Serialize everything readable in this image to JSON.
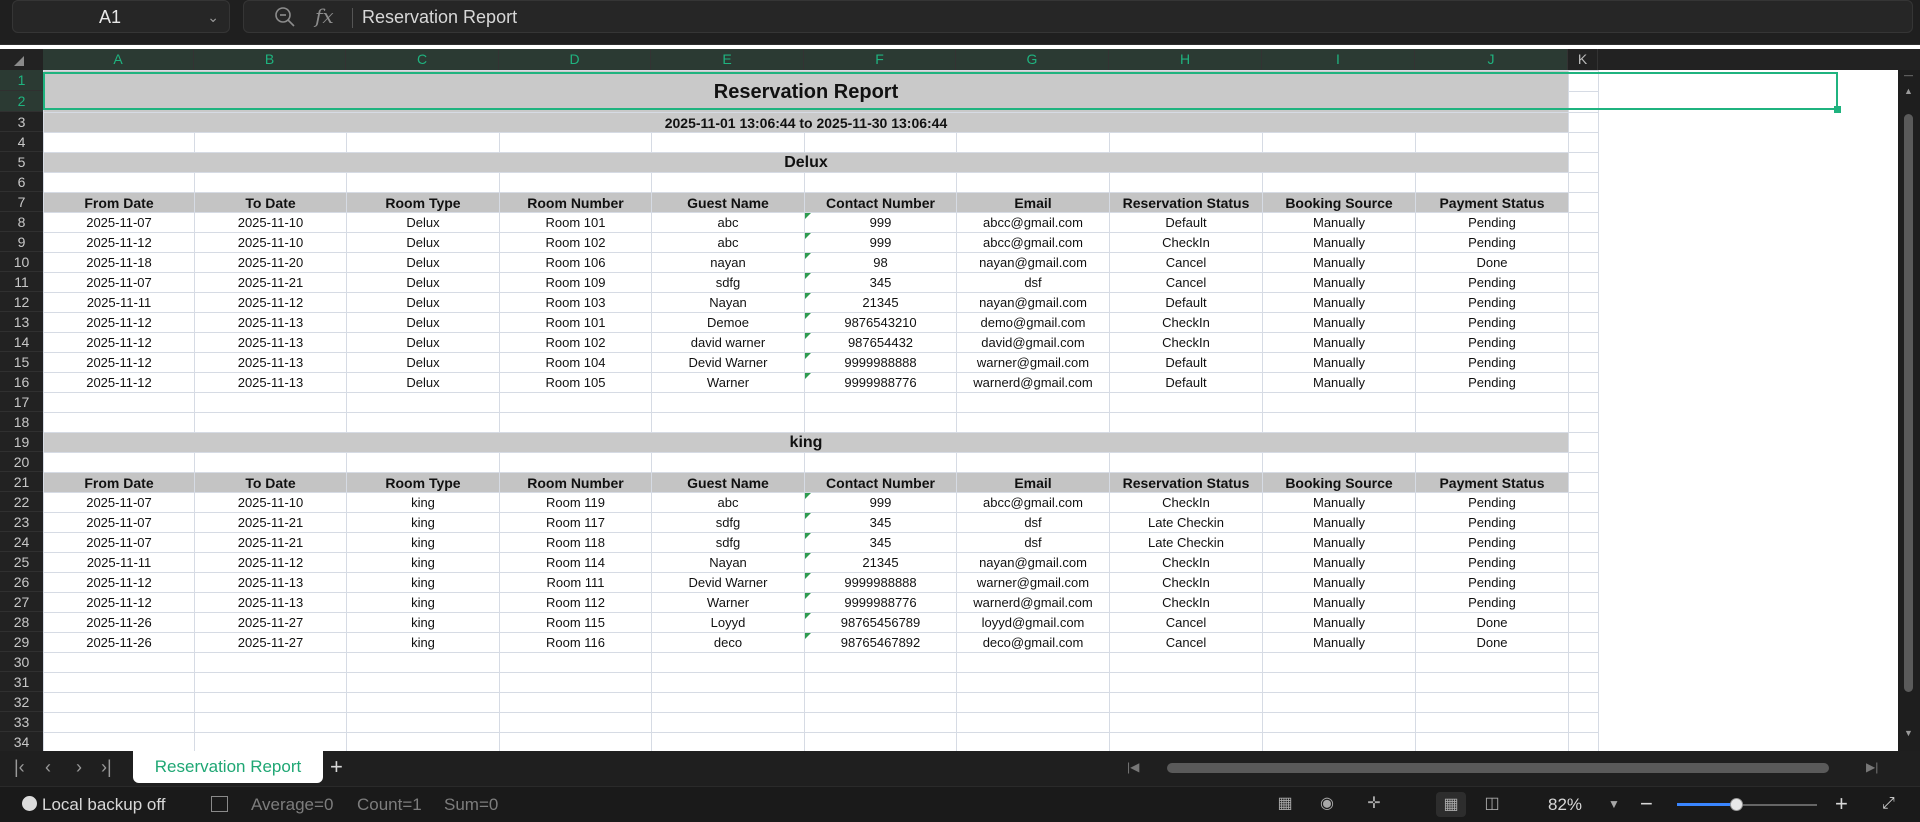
{
  "formula_bar": {
    "cell_ref": "A1",
    "fx_symbol": "fx",
    "content": "Reservation Report"
  },
  "columns": [
    "A",
    "B",
    "C",
    "D",
    "E",
    "F",
    "G",
    "H",
    "I",
    "J",
    "K"
  ],
  "rows": [
    "1",
    "2",
    "3",
    "4",
    "5",
    "6",
    "7",
    "8",
    "9",
    "10",
    "11",
    "12",
    "13",
    "14",
    "15",
    "16",
    "17",
    "18",
    "19",
    "20",
    "21",
    "22",
    "23",
    "24",
    "25",
    "26",
    "27",
    "28",
    "29",
    "30",
    "31",
    "32",
    "33",
    "34"
  ],
  "report": {
    "title": "Reservation Report",
    "date_range": "2025-11-01 13:06:44 to 2025-11-30 13:06:44",
    "headers": [
      "From Date",
      "To Date",
      "Room Type",
      "Room Number",
      "Guest Name",
      "Contact Number",
      "Email",
      "Reservation Status",
      "Booking Source",
      "Payment Status"
    ],
    "sections": [
      {
        "name": "Delux",
        "rows": [
          [
            "2025-11-07",
            "2025-11-10",
            "Delux",
            "Room 101",
            "abc",
            "999",
            "abcc@gmail.com",
            "Default",
            "Manually",
            "Pending"
          ],
          [
            "2025-11-12",
            "2025-11-10",
            "Delux",
            "Room 102",
            "abc",
            "999",
            "abcc@gmail.com",
            "CheckIn",
            "Manually",
            "Pending"
          ],
          [
            "2025-11-18",
            "2025-11-20",
            "Delux",
            "Room 106",
            "nayan",
            "98",
            "nayan@gmail.com",
            "Cancel",
            "Manually",
            "Done"
          ],
          [
            "2025-11-07",
            "2025-11-21",
            "Delux",
            "Room 109",
            "sdfg",
            "345",
            "dsf",
            "Cancel",
            "Manually",
            "Pending"
          ],
          [
            "2025-11-11",
            "2025-11-12",
            "Delux",
            "Room 103",
            "Nayan",
            "21345",
            "nayan@gmail.com",
            "Default",
            "Manually",
            "Pending"
          ],
          [
            "2025-11-12",
            "2025-11-13",
            "Delux",
            "Room 101",
            "Demoe",
            "9876543210",
            "demo@gmail.com",
            "CheckIn",
            "Manually",
            "Pending"
          ],
          [
            "2025-11-12",
            "2025-11-13",
            "Delux",
            "Room 102",
            "david warner",
            "987654432",
            "david@gmail.com",
            "CheckIn",
            "Manually",
            "Pending"
          ],
          [
            "2025-11-12",
            "2025-11-13",
            "Delux",
            "Room 104",
            "Devid Warner",
            "9999988888",
            "warner@gmail.com",
            "Default",
            "Manually",
            "Pending"
          ],
          [
            "2025-11-12",
            "2025-11-13",
            "Delux",
            "Room 105",
            "Warner",
            "9999988776",
            "warnerd@gmail.com",
            "Default",
            "Manually",
            "Pending"
          ]
        ]
      },
      {
        "name": "king",
        "rows": [
          [
            "2025-11-07",
            "2025-11-10",
            "king",
            "Room 119",
            "abc",
            "999",
            "abcc@gmail.com",
            "CheckIn",
            "Manually",
            "Pending"
          ],
          [
            "2025-11-07",
            "2025-11-21",
            "king",
            "Room 117",
            "sdfg",
            "345",
            "dsf",
            "Late Checkin",
            "Manually",
            "Pending"
          ],
          [
            "2025-11-07",
            "2025-11-21",
            "king",
            "Room 118",
            "sdfg",
            "345",
            "dsf",
            "Late Checkin",
            "Manually",
            "Pending"
          ],
          [
            "2025-11-11",
            "2025-11-12",
            "king",
            "Room 114",
            "Nayan",
            "21345",
            "nayan@gmail.com",
            "CheckIn",
            "Manually",
            "Pending"
          ],
          [
            "2025-11-12",
            "2025-11-13",
            "king",
            "Room 111",
            "Devid Warner",
            "9999988888",
            "warner@gmail.com",
            "CheckIn",
            "Manually",
            "Pending"
          ],
          [
            "2025-11-12",
            "2025-11-13",
            "king",
            "Room 112",
            "Warner",
            "9999988776",
            "warnerd@gmail.com",
            "CheckIn",
            "Manually",
            "Pending"
          ],
          [
            "2025-11-26",
            "2025-11-27",
            "king",
            "Room 115",
            "Loyyd",
            "98765456789",
            "loyyd@gmail.com",
            "Cancel",
            "Manually",
            "Done"
          ],
          [
            "2025-11-26",
            "2025-11-27",
            "king",
            "Room 116",
            "deco",
            "98765467892",
            "deco@gmail.com",
            "Cancel",
            "Manually",
            "Done"
          ]
        ]
      }
    ]
  },
  "sheet_tabs": {
    "active": "Reservation Report",
    "add_label": "+"
  },
  "status": {
    "backup": "Local backup off",
    "average": "Average=0",
    "count": "Count=1",
    "sum": "Sum=0",
    "zoom": "82%",
    "zoom_level": 0.42
  },
  "colors": {
    "accent": "#1fb37f",
    "header_fill": "#c4c4c4",
    "comment_marker": "#2e9b4f"
  }
}
